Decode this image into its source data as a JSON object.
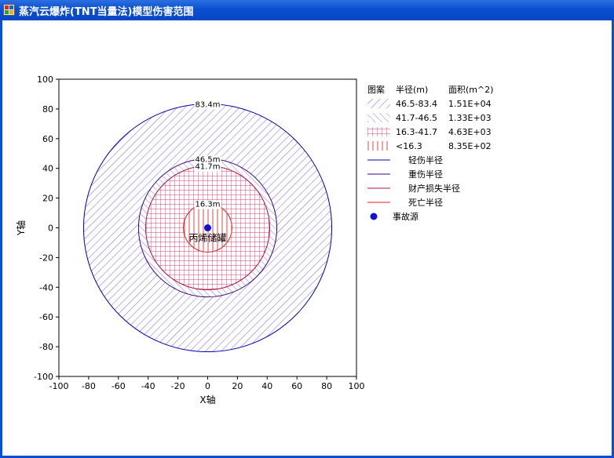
{
  "window": {
    "title": "蒸汽云爆炸(TNT当量法)模型伤害范围",
    "icon_name": "app-icon"
  },
  "colors": {
    "light": "#0000b0",
    "heavy": "#400080",
    "property": "#b01050",
    "death": "#e02020",
    "hatch_light": "#6a6aff",
    "hatch_heavy": "#8080d0",
    "grid_property": "#d04070",
    "source": "#1010e0"
  },
  "chart_data": {
    "type": "damage-zone-circles",
    "xlabel": "X轴",
    "ylabel": "Y轴",
    "xlim": [
      -100,
      100
    ],
    "ylim": [
      -100,
      100
    ],
    "xticks": [
      -100,
      -80,
      -60,
      -40,
      -20,
      0,
      20,
      40,
      60,
      80,
      100
    ],
    "yticks": [
      100,
      80,
      60,
      40,
      20,
      0,
      -20,
      -40,
      -60,
      -80,
      -100
    ],
    "grid": false,
    "legend_position": "right",
    "center": [
      0,
      0
    ],
    "source_label": "丙烯储罐",
    "circles": [
      {
        "key": "light",
        "radius": 83.4,
        "label": "83.4m"
      },
      {
        "key": "heavy",
        "radius": 46.5,
        "label": "46.5m"
      },
      {
        "key": "property",
        "radius": 41.7,
        "label": "41.7m"
      },
      {
        "key": "death",
        "radius": 16.3,
        "label": "16.3m"
      }
    ],
    "legend": {
      "headers": [
        "图案",
        "半径(m)",
        "面积(m^2)"
      ],
      "area_rows": [
        {
          "pattern": "diag-dense",
          "range": "46.5-83.4",
          "area": "1.51E+04"
        },
        {
          "pattern": "diag-back",
          "range": "41.7-46.5",
          "area": "1.33E+03"
        },
        {
          "pattern": "grid",
          "range": "16.3-41.7",
          "area": "4.63E+03"
        },
        {
          "pattern": "vertical",
          "range": "<16.3",
          "area": "8.35E+02"
        }
      ],
      "line_rows": [
        {
          "key": "light",
          "label": "轻伤半径"
        },
        {
          "key": "heavy",
          "label": "重伤半径"
        },
        {
          "key": "property",
          "label": "财产损失半径"
        },
        {
          "key": "death",
          "label": "死亡半径"
        }
      ],
      "source_row": {
        "label": "事故源"
      }
    }
  }
}
